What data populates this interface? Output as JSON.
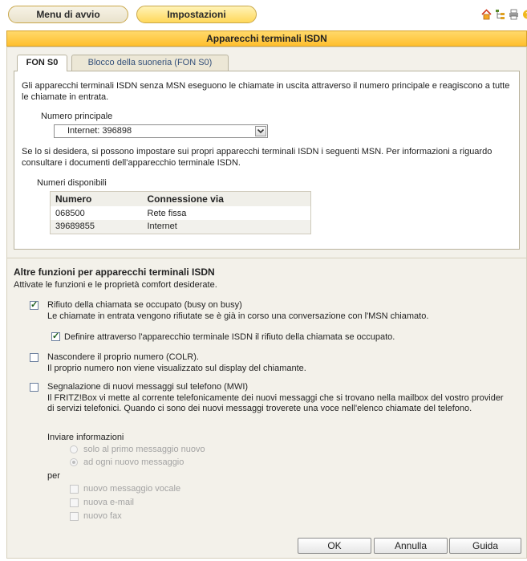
{
  "nav": {
    "menu_label": "Menu di avvio",
    "settings_label": "Impostazioni"
  },
  "header": {
    "title": "Apparecchi terminali ISDN"
  },
  "tabs": [
    {
      "label": "FON S0",
      "active": true
    },
    {
      "label": "Blocco della suoneria (FON S0)",
      "active": false
    }
  ],
  "panel": {
    "intro": "Gli apparecchi terminali ISDN senza MSN eseguono le chiamate in uscita attraverso il numero principale e reagiscono a tutte le chiamate in entrata.",
    "main_number_label": "Numero principale",
    "main_number_value": "Internet: 396898",
    "msn_text": "Se lo si desidera, si possono impostare sui propri apparecchi terminali ISDN i seguenti MSN. Per informazioni a riguardo consultare i documenti dell'apparecchio terminale ISDN.",
    "available_label": "Numeri disponibili",
    "table": {
      "headers": [
        "Numero",
        "Connessione via"
      ],
      "rows": [
        [
          "068500",
          "Rete fissa"
        ],
        [
          "39689855",
          "Internet"
        ]
      ]
    }
  },
  "features": {
    "title": "Altre funzioni per apparecchi terminali ISDN",
    "subtitle": "Attivate le funzioni e le proprietà comfort desiderate.",
    "busy_label": "Rifiuto della chiamata se occupato (busy on busy)",
    "busy_desc": "Le chiamate in entrata vengono rifiutate se è già in corso una conversazione con l'MSN chiamato.",
    "busy_checked": true,
    "busy_sub_label": "Definire attraverso l'apparecchio terminale ISDN il rifiuto della chiamata se occupato.",
    "busy_sub_checked": true,
    "colr_label": "Nascondere il proprio numero (COLR).",
    "colr_desc": "Il proprio numero non viene visualizzato sul display del chiamante.",
    "colr_checked": false,
    "mwi_label": "Segnalazione di nuovi messaggi sul telefono (MWI)",
    "mwi_desc": "Il FRITZ!Box vi mette al corrente telefonicamente dei nuovi messaggi che si trovano nella mailbox del vostro provider di servizi telefonici. Quando ci sono dei nuovi messaggi troverete una voce nell'elenco chiamate del telefono.",
    "mwi_checked": false,
    "send_info_label": "Inviare informazioni",
    "radio_first": "solo al primo messaggio nuovo",
    "radio_each": "ad ogni nuovo messaggio",
    "per_label": "per",
    "opt_voice": "nuovo messaggio vocale",
    "opt_email": "nuova e-mail",
    "opt_fax": "nuovo fax"
  },
  "buttons": {
    "ok": "OK",
    "cancel": "Annulla",
    "help": "Guida"
  },
  "colors": {
    "accent": "#ffbf2e",
    "frame": "#f3f1ea",
    "check": "#1d5e1d"
  },
  "icons": [
    "home-icon",
    "sitemap-icon",
    "print-icon",
    "help-icon"
  ]
}
